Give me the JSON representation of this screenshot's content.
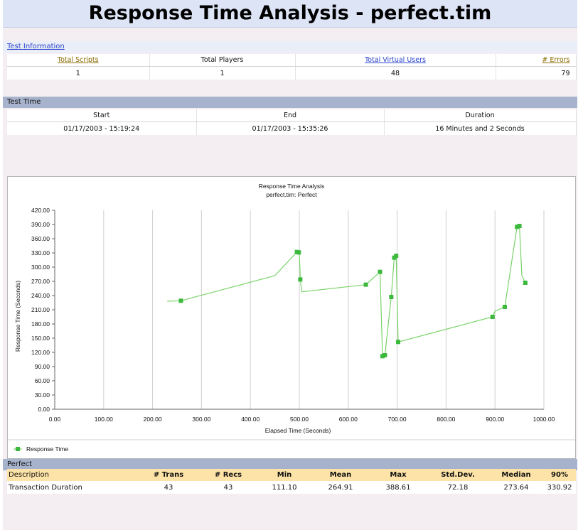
{
  "page_title": "Response Time Analysis - perfect.tim",
  "test_info": {
    "heading": "Test Information",
    "columns": [
      "Total Scripts",
      "Total Players",
      "Total Virtual Users",
      "# Errors"
    ],
    "values": [
      "1",
      "1",
      "48",
      "79"
    ]
  },
  "test_time": {
    "heading": "Test Time",
    "columns": [
      "Start",
      "End",
      "Duration"
    ],
    "values": [
      "01/17/2003 - 15:19:24",
      "01/17/2003 - 15:35:26",
      "16 Minutes and 2 Seconds"
    ]
  },
  "chart_data": {
    "type": "line",
    "title": "Response Time Analysis",
    "subtitle": "perfect.tim: Perfect",
    "xlabel": "Elapsed Time (Seconds)",
    "ylabel": "Response Time (Seconds)",
    "xlim": [
      0,
      1000
    ],
    "ylim": [
      0,
      420
    ],
    "x_ticks": [
      "0.00",
      "100.00",
      "200.00",
      "300.00",
      "400.00",
      "500.00",
      "600.00",
      "700.00",
      "800.00",
      "900.00",
      "1000.00"
    ],
    "y_ticks": [
      "0.00",
      "30.00",
      "60.00",
      "90.00",
      "120.00",
      "150.00",
      "180.00",
      "210.00",
      "240.00",
      "270.00",
      "300.00",
      "330.00",
      "360.00",
      "390.00",
      "420.00"
    ],
    "grid": "vertical",
    "legend_position": "bottom-left",
    "series": [
      {
        "name": "Response Time",
        "color": "#7ad36a",
        "marker_color": "#3cb93c",
        "line": [
          [
            230,
            228
          ],
          [
            258,
            229
          ],
          [
            450,
            282
          ],
          [
            495,
            332
          ],
          [
            500,
            330
          ],
          [
            502,
            274
          ],
          [
            505,
            248
          ],
          [
            636,
            263
          ],
          [
            665,
            290
          ],
          [
            670,
            112
          ],
          [
            675,
            114
          ],
          [
            688,
            237
          ],
          [
            694,
            320
          ],
          [
            698,
            324
          ],
          [
            702,
            142
          ],
          [
            895,
            195
          ],
          [
            900,
            207
          ],
          [
            920,
            216
          ],
          [
            945,
            385
          ],
          [
            950,
            387
          ],
          [
            955,
            282
          ],
          [
            962,
            267
          ]
        ],
        "markers": [
          [
            258,
            229
          ],
          [
            495,
            332
          ],
          [
            499,
            331
          ],
          [
            502,
            274
          ],
          [
            636,
            263
          ],
          [
            665,
            290
          ],
          [
            670,
            112
          ],
          [
            675,
            114
          ],
          [
            688,
            237
          ],
          [
            694,
            320
          ],
          [
            698,
            324
          ],
          [
            702,
            142
          ],
          [
            895,
            195
          ],
          [
            920,
            216
          ],
          [
            945,
            385
          ],
          [
            950,
            387
          ],
          [
            962,
            267
          ]
        ]
      }
    ]
  },
  "perfect": {
    "heading": "Perfect",
    "columns": [
      "Description",
      "# Trans",
      "# Recs",
      "Min",
      "Mean",
      "Max",
      "Std.Dev.",
      "Median",
      "90%"
    ],
    "rows": [
      [
        "Transaction Duration",
        "43",
        "43",
        "111.10",
        "264.91",
        "388.61",
        "72.18",
        "273.64",
        "330.92"
      ]
    ]
  }
}
